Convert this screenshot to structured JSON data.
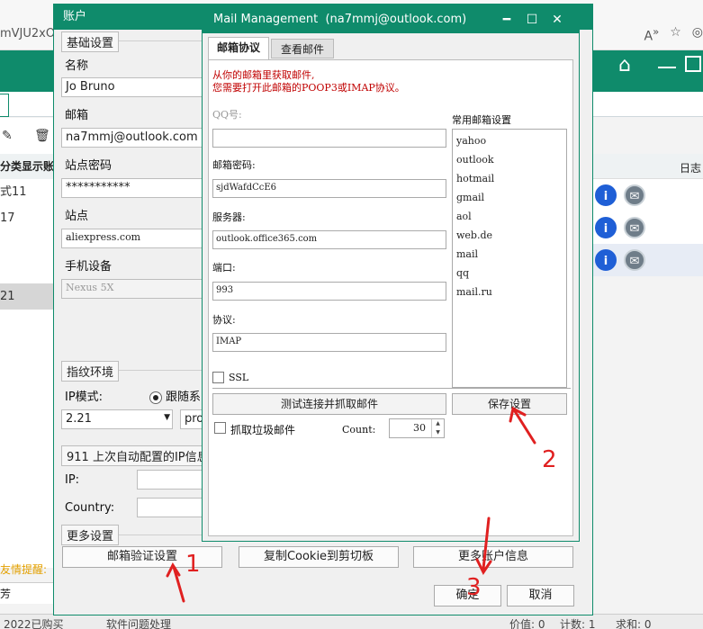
{
  "browser": {
    "url_fragment": "mVJU2xO",
    "icons": [
      "read-aloud-icon",
      "favorite-icon",
      "extensions-icon"
    ]
  },
  "app": {
    "left_header": "分类显示账号",
    "left_rows": [
      "式11",
      "17",
      "",
      "",
      "21"
    ],
    "right_header": "日志",
    "notice": "友情提醒:",
    "bottom_row": "芳",
    "status": [
      "2022已购买",
      "软件问题处理",
      "",
      "",
      "",
      "",
      ""
    ],
    "status_values": {
      "a": "价值: 0",
      "b": "计数: 1",
      "c": "求和: 0"
    }
  },
  "account_dialog": {
    "title": "账户",
    "group_basic": "基础设置",
    "name_label": "名称",
    "name_value": "Jo Bruno",
    "email_label": "邮箱",
    "email_value": "na7mmj@outlook.com",
    "site_password_label": "站点密码",
    "site_password_value": "***********",
    "site_label": "站点",
    "site_value": "aliexpress.com",
    "device_label": "手机设备",
    "device_value": "Nexus 5X",
    "group_fingerprint": "指纹环境",
    "ip_mode_label": "IP模式:",
    "ip_mode_option": "跟随系",
    "ip_version_value": "2.21",
    "protocol_partial": "pro",
    "group_911": "911 上次自动配置的IP信息",
    "ip_label": "IP:",
    "country_label": "Country:",
    "group_more": "更多设置",
    "btn_email_verify": "邮箱验证设置",
    "btn_copy_cookie": "复制Cookie到剪切板",
    "btn_more_account": "更多账户信息",
    "btn_ok": "确定",
    "btn_cancel": "取消"
  },
  "mail_dialog": {
    "title": "Mail Management  (na7mmj@outlook.com)",
    "tab_protocol": "邮箱协议",
    "tab_view": "查看邮件",
    "notice_line1": "从你的邮箱里获取邮件,",
    "notice_line2": "您需要打开此邮箱的POOP3或IMAP协议。",
    "qq_label": "QQ号:",
    "qq_value": "",
    "password_label": "邮箱密码:",
    "password_value": "sjdWafdCcE6",
    "server_label": "服务器:",
    "server_value": "outlook.office365.com",
    "port_label": "端口:",
    "port_value": "993",
    "protocol_label": "协议:",
    "protocol_value": "IMAP",
    "ssl_label": "SSL",
    "common_label": "常用邮箱设置",
    "providers": [
      "yahoo",
      "outlook",
      "hotmail",
      "gmail",
      "aol",
      "web.de",
      "mail",
      "qq",
      "mail.ru"
    ],
    "btn_test": "测试连接并抓取邮件",
    "btn_save": "保存设置",
    "junk_label": "抓取垃圾邮件",
    "count_label": "Count:",
    "count_value": "30"
  },
  "annotations": {
    "n1": "1",
    "n2": "2",
    "n3": "3",
    "color": "#e02020"
  },
  "colors": {
    "brand_green": "#0f8b6b",
    "warning_red": "#c00000"
  }
}
